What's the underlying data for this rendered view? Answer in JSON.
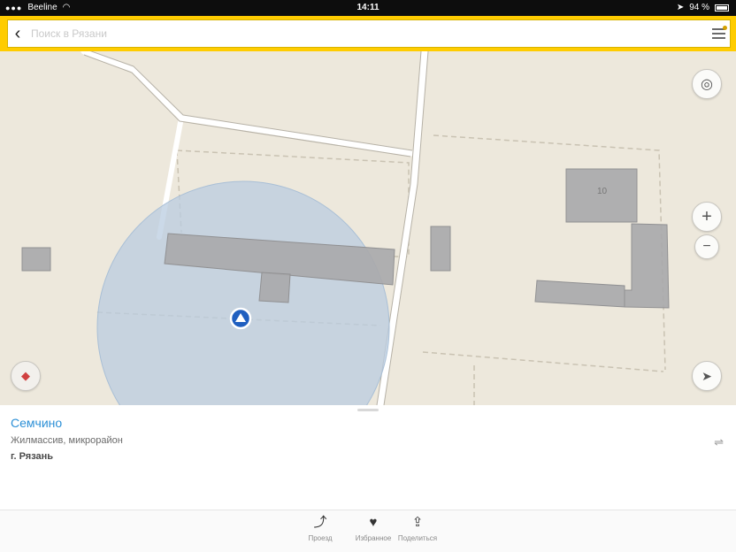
{
  "status_bar": {
    "signal": "●●●",
    "carrier": "Beeline",
    "time": "14:11",
    "battery_text": "94 %"
  },
  "search": {
    "placeholder": "Поиск в Рязани"
  },
  "map": {
    "building_number": "10"
  },
  "place": {
    "name": "Семчино",
    "type": "Жилмассив, микрорайон",
    "city": "г. Рязань"
  },
  "actions": [
    {
      "icon": "route-icon",
      "label": "Проезд"
    },
    {
      "icon": "heart-icon",
      "label": "Избранное"
    },
    {
      "icon": "share-icon",
      "label": "Поделиться"
    }
  ],
  "colors": {
    "accent": "#ffcc00",
    "map_background": "#ede8dc",
    "building": "#a9a9ab",
    "accuracy_circle": "#b9cce0",
    "location_marker": "#1f5fc0",
    "place_name": "#2b8fd6"
  }
}
